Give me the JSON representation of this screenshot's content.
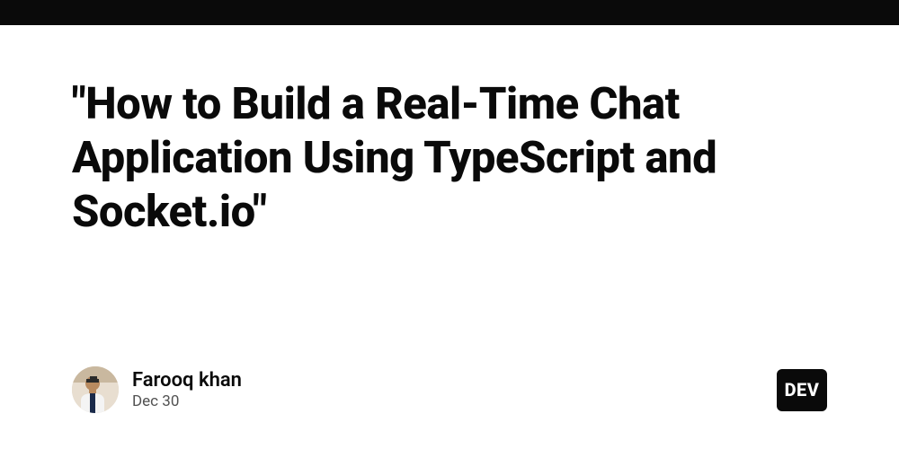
{
  "article": {
    "title": "\"How to Build a Real-Time Chat Application Using TypeScript and Socket.io\""
  },
  "author": {
    "name": "Farooq khan",
    "date": "Dec 30"
  },
  "badge": {
    "label": "DEV"
  }
}
